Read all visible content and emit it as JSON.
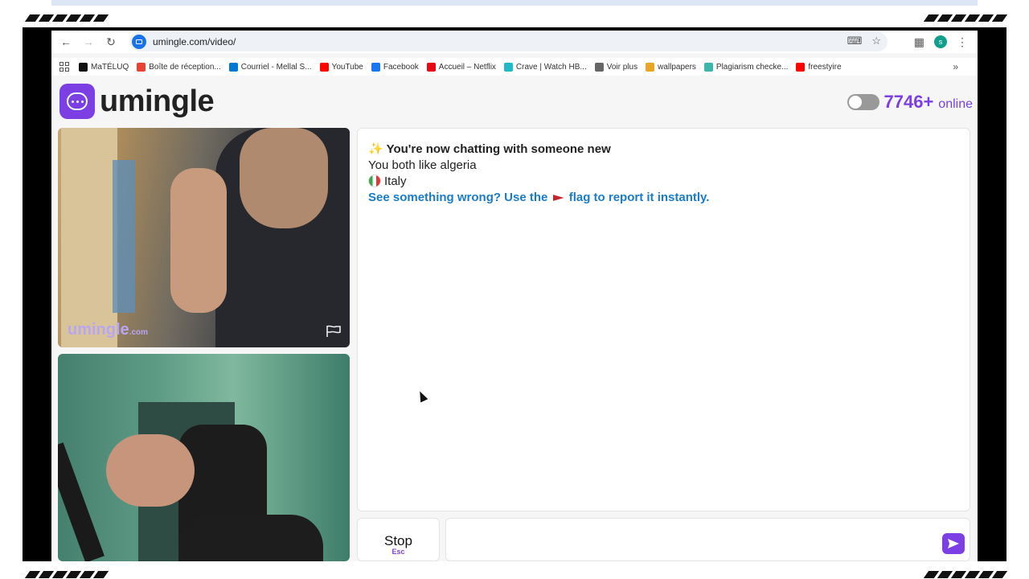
{
  "browser": {
    "url": "umingle.com/video/",
    "profile_initial": "s",
    "bookmarks": [
      {
        "label": "MaTÉLUQ",
        "color": "#111111"
      },
      {
        "label": "Boîte de réception...",
        "color": "#ea4335"
      },
      {
        "label": "Courriel - Mellal S...",
        "color": "#0078d4"
      },
      {
        "label": "YouTube",
        "color": "#ff0000"
      },
      {
        "label": "Facebook",
        "color": "#1877f2"
      },
      {
        "label": "Accueil – Netflix",
        "color": "#e50914"
      },
      {
        "label": "Crave | Watch HB...",
        "color": "#22b8c8"
      },
      {
        "label": "Voir plus",
        "color": "#666666"
      },
      {
        "label": "wallpapers",
        "color": "#e8a623"
      },
      {
        "label": "Plagiarism checke...",
        "color": "#3ab7a8"
      },
      {
        "label": "freestyire",
        "color": "#ff0000"
      }
    ],
    "more_bookmarks": "»"
  },
  "site": {
    "logo_text": "umingle",
    "online_count": "7746+",
    "online_label": "online",
    "watermark": "umingle",
    "watermark_suffix": ".com"
  },
  "chat": {
    "sparkle": "✨",
    "intro": "You're now chatting with someone new",
    "common_interest": "You both like algeria",
    "country": "Italy",
    "report_prefix": "See something wrong? Use the",
    "report_suffix": "flag to report it instantly."
  },
  "controls": {
    "stop_label": "Stop",
    "stop_shortcut": "Esc",
    "message_placeholder": ""
  },
  "colors": {
    "accent": "#7b3fe4",
    "report_link": "#1a7cc9"
  }
}
